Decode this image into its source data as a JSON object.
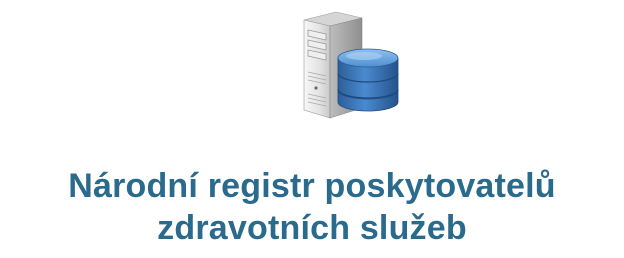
{
  "tile": {
    "icon": "server-database-icon",
    "title_line1": "Národní registr poskytovatelů",
    "title_line2": "zdravotních služeb"
  },
  "colors": {
    "title": "#2a6b8d",
    "server_body": "#e9e9e9",
    "database": "#3d78b8"
  }
}
